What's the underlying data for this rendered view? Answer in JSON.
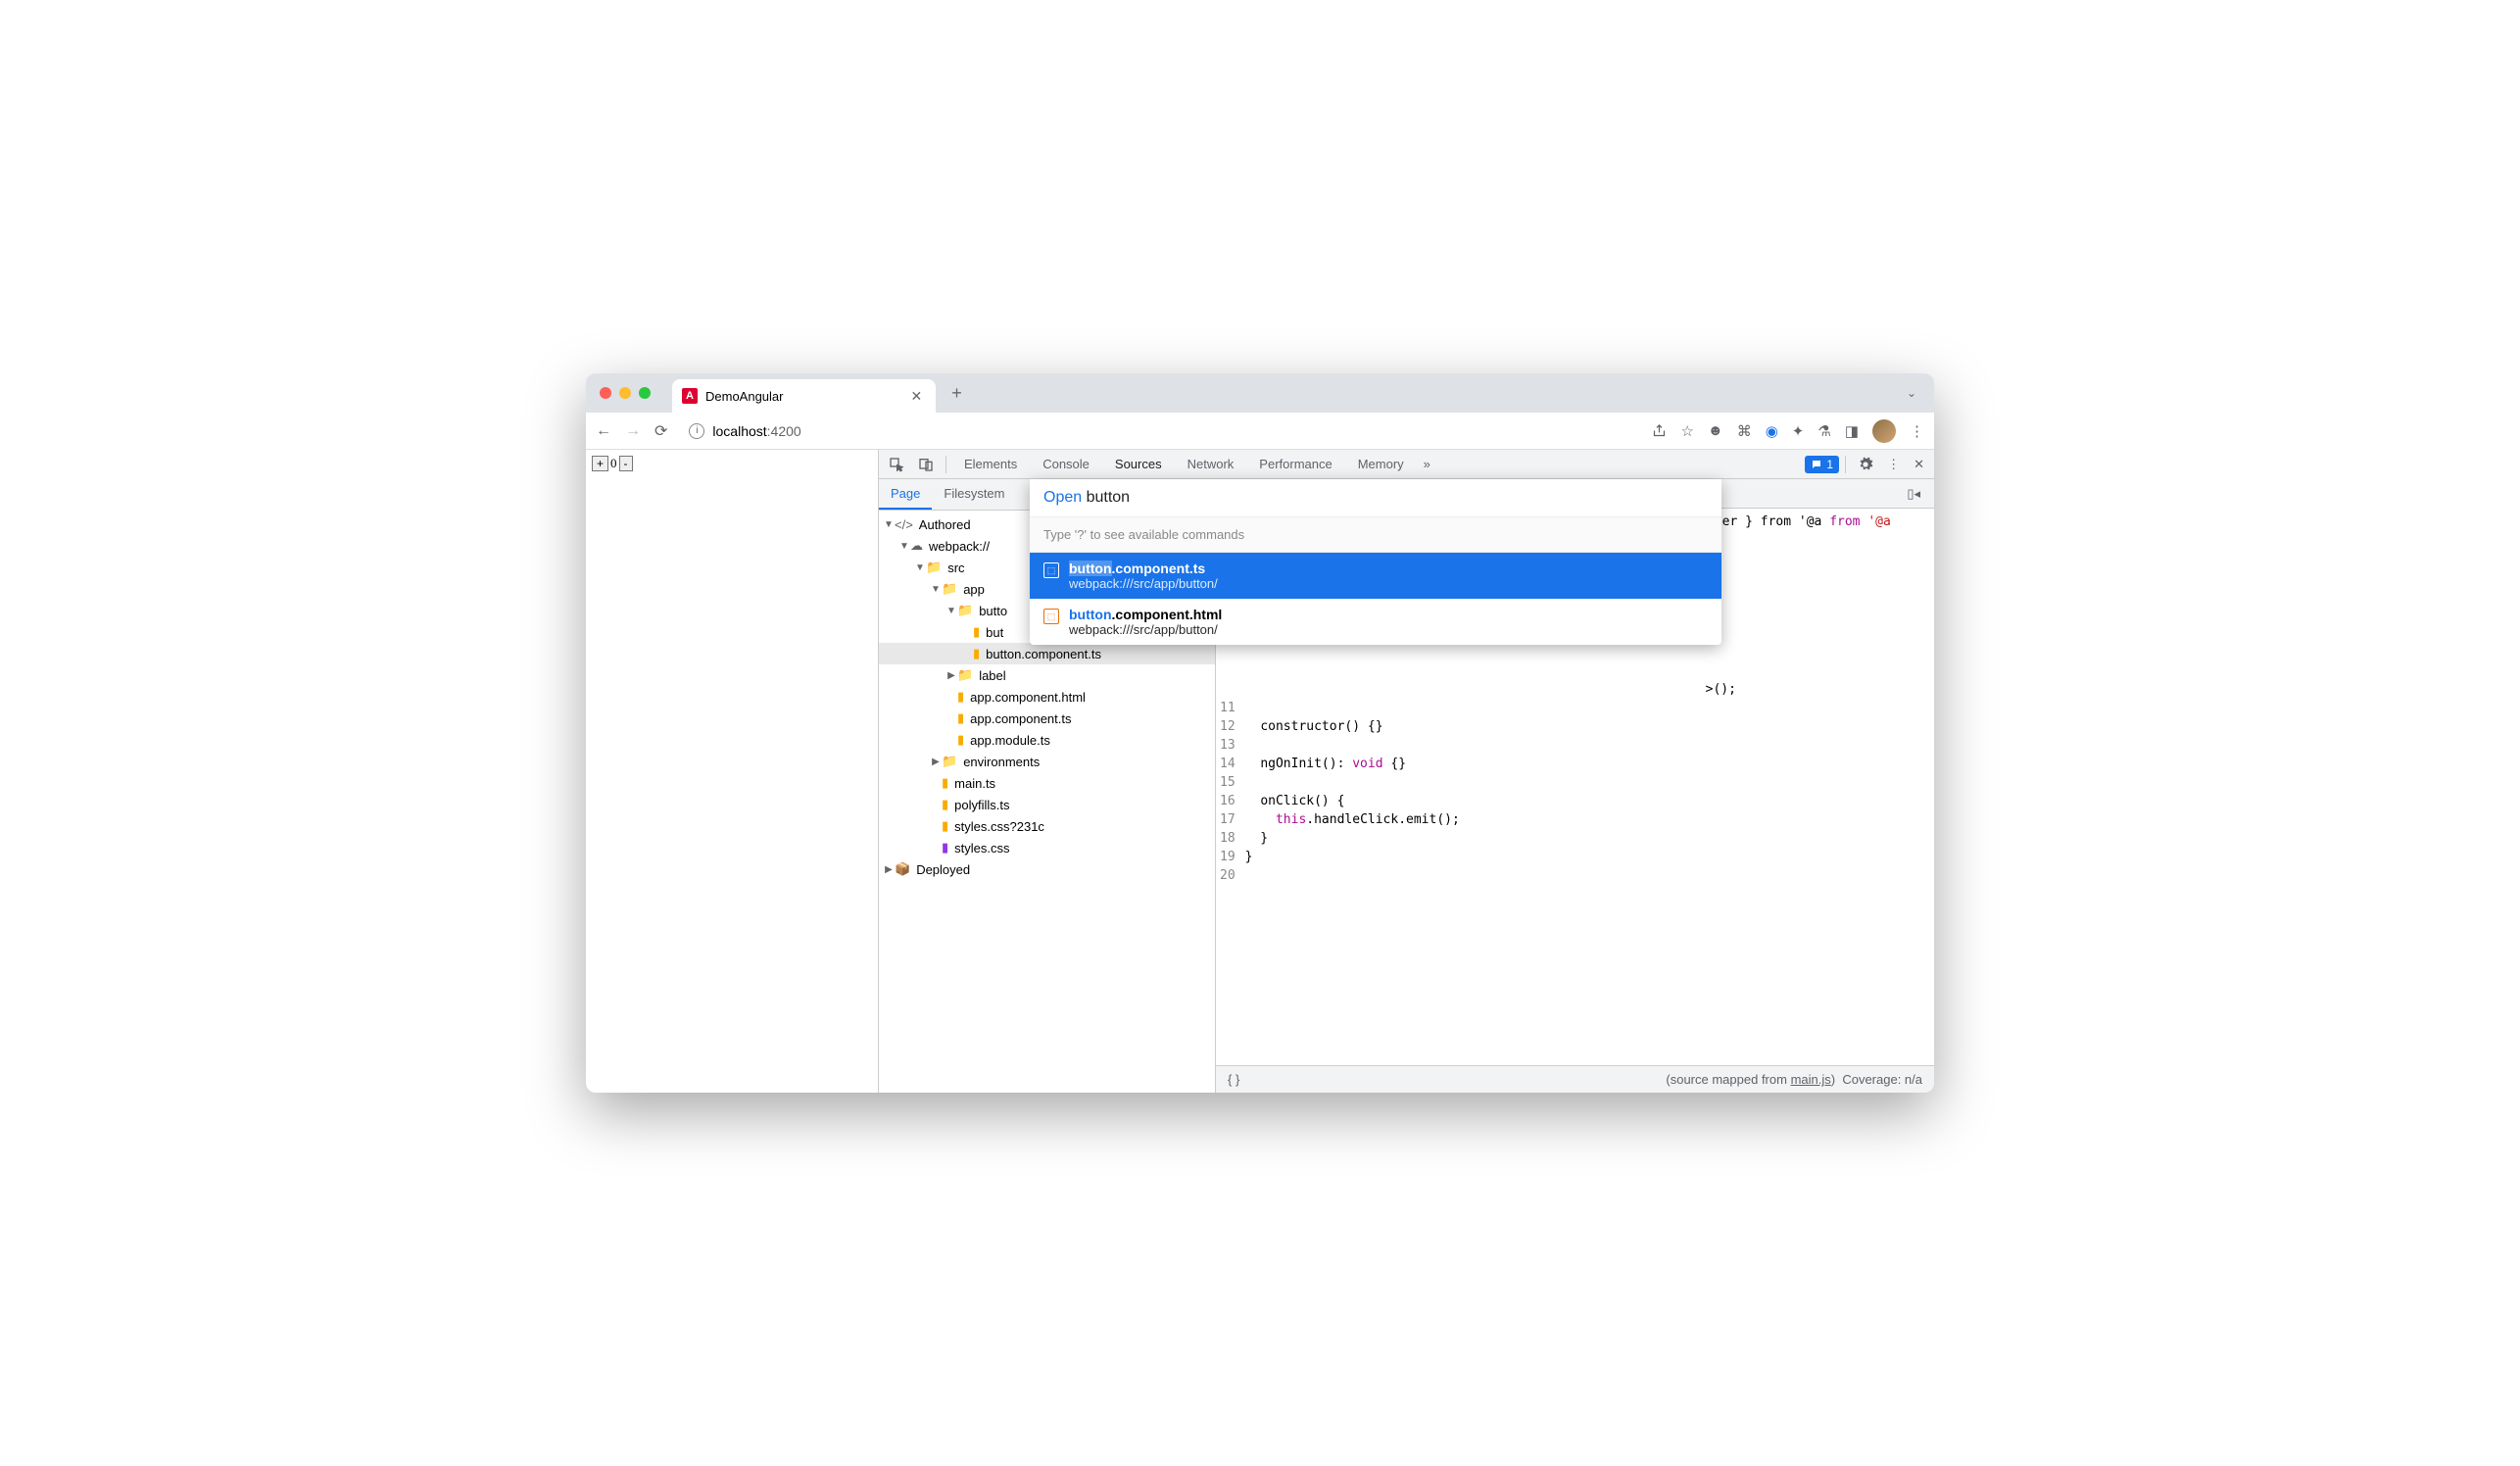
{
  "browser": {
    "tab_title": "DemoAngular",
    "url_host": "localhost",
    "url_port": ":4200"
  },
  "page": {
    "counter_plus": "+",
    "counter_value": "0",
    "counter_minus": "-"
  },
  "devtools": {
    "panels": [
      "Elements",
      "Console",
      "Sources",
      "Network",
      "Performance",
      "Memory"
    ],
    "active_panel": "Sources",
    "issues_count": "1",
    "sidebar_tabs": [
      "Page",
      "Filesystem"
    ],
    "active_sidebar_tab": "Page",
    "tree": {
      "authored": "Authored",
      "webpack": "webpack://",
      "src": "src",
      "app": "app",
      "button_dir": "butto",
      "button_html": "but",
      "button_ts": "button.component.ts",
      "label": "label",
      "app_html": "app.component.html",
      "app_ts": "app.component.ts",
      "app_module": "app.module.ts",
      "environments": "environments",
      "main_ts": "main.ts",
      "polyfills": "polyfills.ts",
      "styles_q": "styles.css?231c",
      "styles": "styles.css",
      "deployed": "Deployed"
    },
    "code": {
      "line1_tail": "Emitter } from '@a",
      "line10_tail": ">();",
      "constructor": "constructor() {}",
      "ngoninit_a": "ngOnInit(): ",
      "ngoninit_b": "void",
      "ngoninit_c": " {}",
      "onclick": "onClick() {",
      "emit_a": "this",
      "emit_b": ".handleClick.emit();",
      "brace": "  }",
      "brace2": "}"
    },
    "status": {
      "mapped_prefix": "(source mapped from ",
      "mapped_file": "main.js",
      "mapped_suffix": ")",
      "coverage": "Coverage: n/a"
    }
  },
  "popup": {
    "label": "Open",
    "query": "button",
    "hint": "Type '?' to see available commands",
    "items": [
      {
        "title_hl": "button",
        "title_rest": ".component.ts",
        "subtitle": "webpack:///src/app/button/",
        "selected": true
      },
      {
        "title_hl": "button",
        "title_rest": ".component.html",
        "subtitle": "webpack:///src/app/button/",
        "selected": false
      }
    ]
  }
}
